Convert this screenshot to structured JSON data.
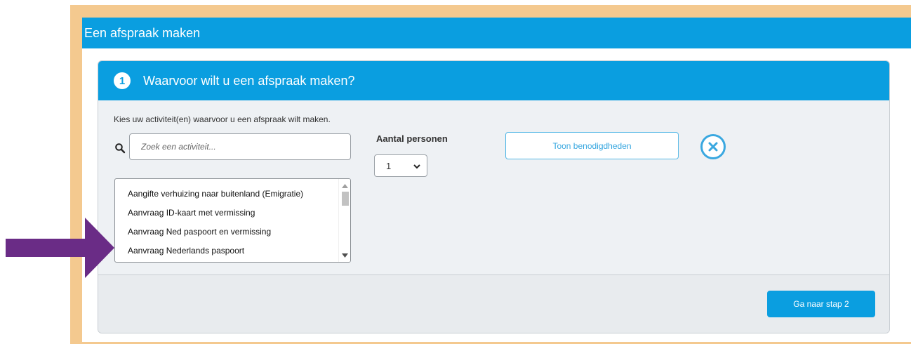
{
  "window": {
    "title": "Een afspraak maken"
  },
  "step": {
    "number": "1",
    "title": "Waarvoor wilt u een afspraak maken?"
  },
  "intro": "Kies uw activiteit(en) waarvoor u een afspraak wilt maken.",
  "search": {
    "placeholder": "Zoek een activiteit...",
    "value": "",
    "icon": "search-icon"
  },
  "persons": {
    "label": "Aantal personen",
    "selected": "1",
    "icon": "chevron-down-icon"
  },
  "actions": {
    "show_label": "Toon benodigdheden",
    "close_icon": "close-icon",
    "next_label": "Ga naar stap 2"
  },
  "activities": [
    "Aangifte verhuizing naar buitenland (Emigratie)",
    "Aanvraag ID-kaart met vermissing",
    "Aanvraag Ned paspoort en vermissing",
    "Aanvraag Nederlands paspoort"
  ],
  "annotation": {
    "icon": "arrow-right-icon",
    "color": "#6a2c86"
  },
  "colors": {
    "primary": "#0a9ee0",
    "frame": "#f4c98f",
    "outline": "#3aa8e0"
  }
}
